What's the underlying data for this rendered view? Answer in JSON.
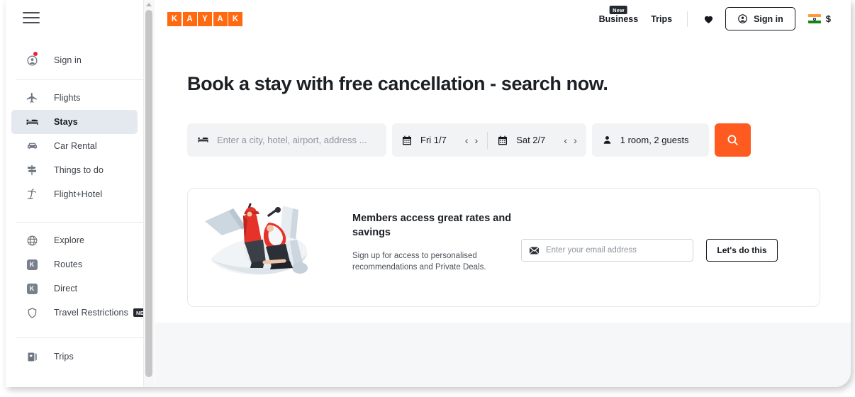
{
  "sidebar": {
    "menu_icon": "hamburger-icon",
    "account": {
      "label": "Sign in",
      "icon": "avatar-icon",
      "has_notification": true
    },
    "groups": [
      {
        "items": [
          {
            "label": "Flights",
            "icon": "airplane-icon",
            "active": false
          },
          {
            "label": "Stays",
            "icon": "bed-icon",
            "active": true
          },
          {
            "label": "Car Rental",
            "icon": "car-icon",
            "active": false
          },
          {
            "label": "Things to do",
            "icon": "signpost-icon",
            "active": false
          },
          {
            "label": "Flight+Hotel",
            "icon": "palm-tree-icon",
            "active": false
          }
        ]
      },
      {
        "items": [
          {
            "label": "Explore",
            "icon": "globe-icon",
            "active": false,
            "badge": ""
          },
          {
            "label": "Routes",
            "icon": "k-tile-icon",
            "active": false,
            "badge": ""
          },
          {
            "label": "Direct",
            "icon": "k-tile-icon",
            "active": false,
            "badge": ""
          },
          {
            "label": "Travel Restrictions",
            "icon": "shield-icon",
            "active": false,
            "badge": "NEW"
          }
        ]
      },
      {
        "items": [
          {
            "label": "Trips",
            "icon": "trips-book-icon",
            "active": false
          }
        ]
      }
    ],
    "k_tile_letter": "K"
  },
  "header": {
    "logo_letters": [
      "K",
      "A",
      "Y",
      "A",
      "K"
    ],
    "business": {
      "label": "Business",
      "badge": "New"
    },
    "trips": {
      "label": "Trips"
    },
    "favorites_icon": "heart-icon",
    "signin": {
      "label": "Sign in",
      "icon": "avatar-icon"
    },
    "locale": {
      "flag": "india-flag-icon",
      "currency": "$"
    }
  },
  "main": {
    "headline": "Book a stay with free cancellation - search now.",
    "search": {
      "location": {
        "icon": "bed-icon",
        "placeholder": "Enter a city, hotel, airport, address ...",
        "value": ""
      },
      "checkin": {
        "icon": "calendar-icon",
        "value": "Fri 1/7"
      },
      "checkout": {
        "icon": "calendar-icon",
        "value": "Sat 2/7"
      },
      "prev_arrow": "‹",
      "next_arrow": "›",
      "guests": {
        "icon": "person-icon",
        "value": "1 room, 2 guests"
      },
      "submit_icon": "search-icon",
      "accent_color": "#ff5a1f"
    },
    "promo": {
      "illustration": "people-riding-airplane-illustration",
      "title": "Members access great rates and savings",
      "subtitle": "Sign up for access to personalised recommendations and Private Deals.",
      "email": {
        "icon": "envelope-icon",
        "placeholder": "Enter your email address",
        "value": ""
      },
      "cta_label": "Let's do this"
    }
  },
  "colors": {
    "brand_orange": "#ff690f",
    "search_orange": "#ff5a1f",
    "active_nav_bg": "#e3e9ef",
    "ink": "#15191e",
    "band_bg": "#f6f7f9"
  }
}
